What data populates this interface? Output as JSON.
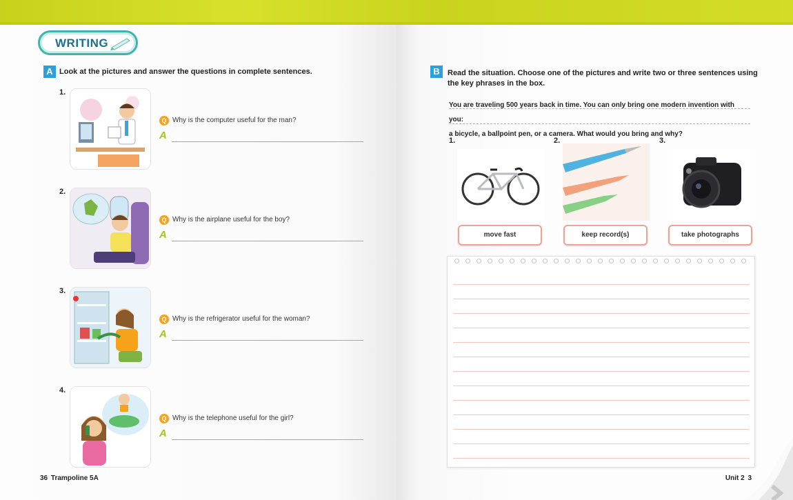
{
  "section_title": "WRITING",
  "part_a": {
    "badge": "A",
    "instruction": "Look at the pictures and answer the questions in complete sentences.",
    "q_icon": "Q",
    "a_icon": "A",
    "questions": [
      {
        "number": "1.",
        "text": "Why is the computer useful for the man?",
        "image": "man-at-computer-illustration"
      },
      {
        "number": "2.",
        "text": "Why is the airplane useful for the boy?",
        "image": "boy-on-airplane-illustration"
      },
      {
        "number": "3.",
        "text": "Why is the refrigerator useful for the woman?",
        "image": "woman-at-refrigerator-illustration"
      },
      {
        "number": "4.",
        "text": "Why is the telephone useful for the girl?",
        "image": "girl-on-telephone-illustration"
      }
    ]
  },
  "part_b": {
    "badge": "B",
    "instruction_line1": "Read the situation. Choose one of the pictures and write two or three sentences using",
    "instruction_line2": "the key phrases in the box.",
    "situation_line1": "You are traveling 500 years back in time. You can only bring one modern invention with you:",
    "situation_line2": "a bicycle, a ballpoint pen, or a camera. What would you bring and why?",
    "options": [
      {
        "number": "1.",
        "image": "bicycle-photo",
        "phrase": "move fast"
      },
      {
        "number": "2.",
        "image": "ballpoint-pens-photo",
        "phrase": "keep record(s)"
      },
      {
        "number": "3.",
        "image": "camera-photo",
        "phrase": "take photographs"
      }
    ]
  },
  "footer": {
    "left_page_number": "36",
    "left_book_title": "Trampoline 5A",
    "right_unit": "Unit 2",
    "right_page_number": "3"
  },
  "colors": {
    "top_band": "#c7d31a",
    "section_badge": "#2e9fd8",
    "writing_border": "#3cb5ae",
    "q_icon": "#f7a21b",
    "a_icon": "#a6c419",
    "phrase_border": "#f0a394"
  }
}
